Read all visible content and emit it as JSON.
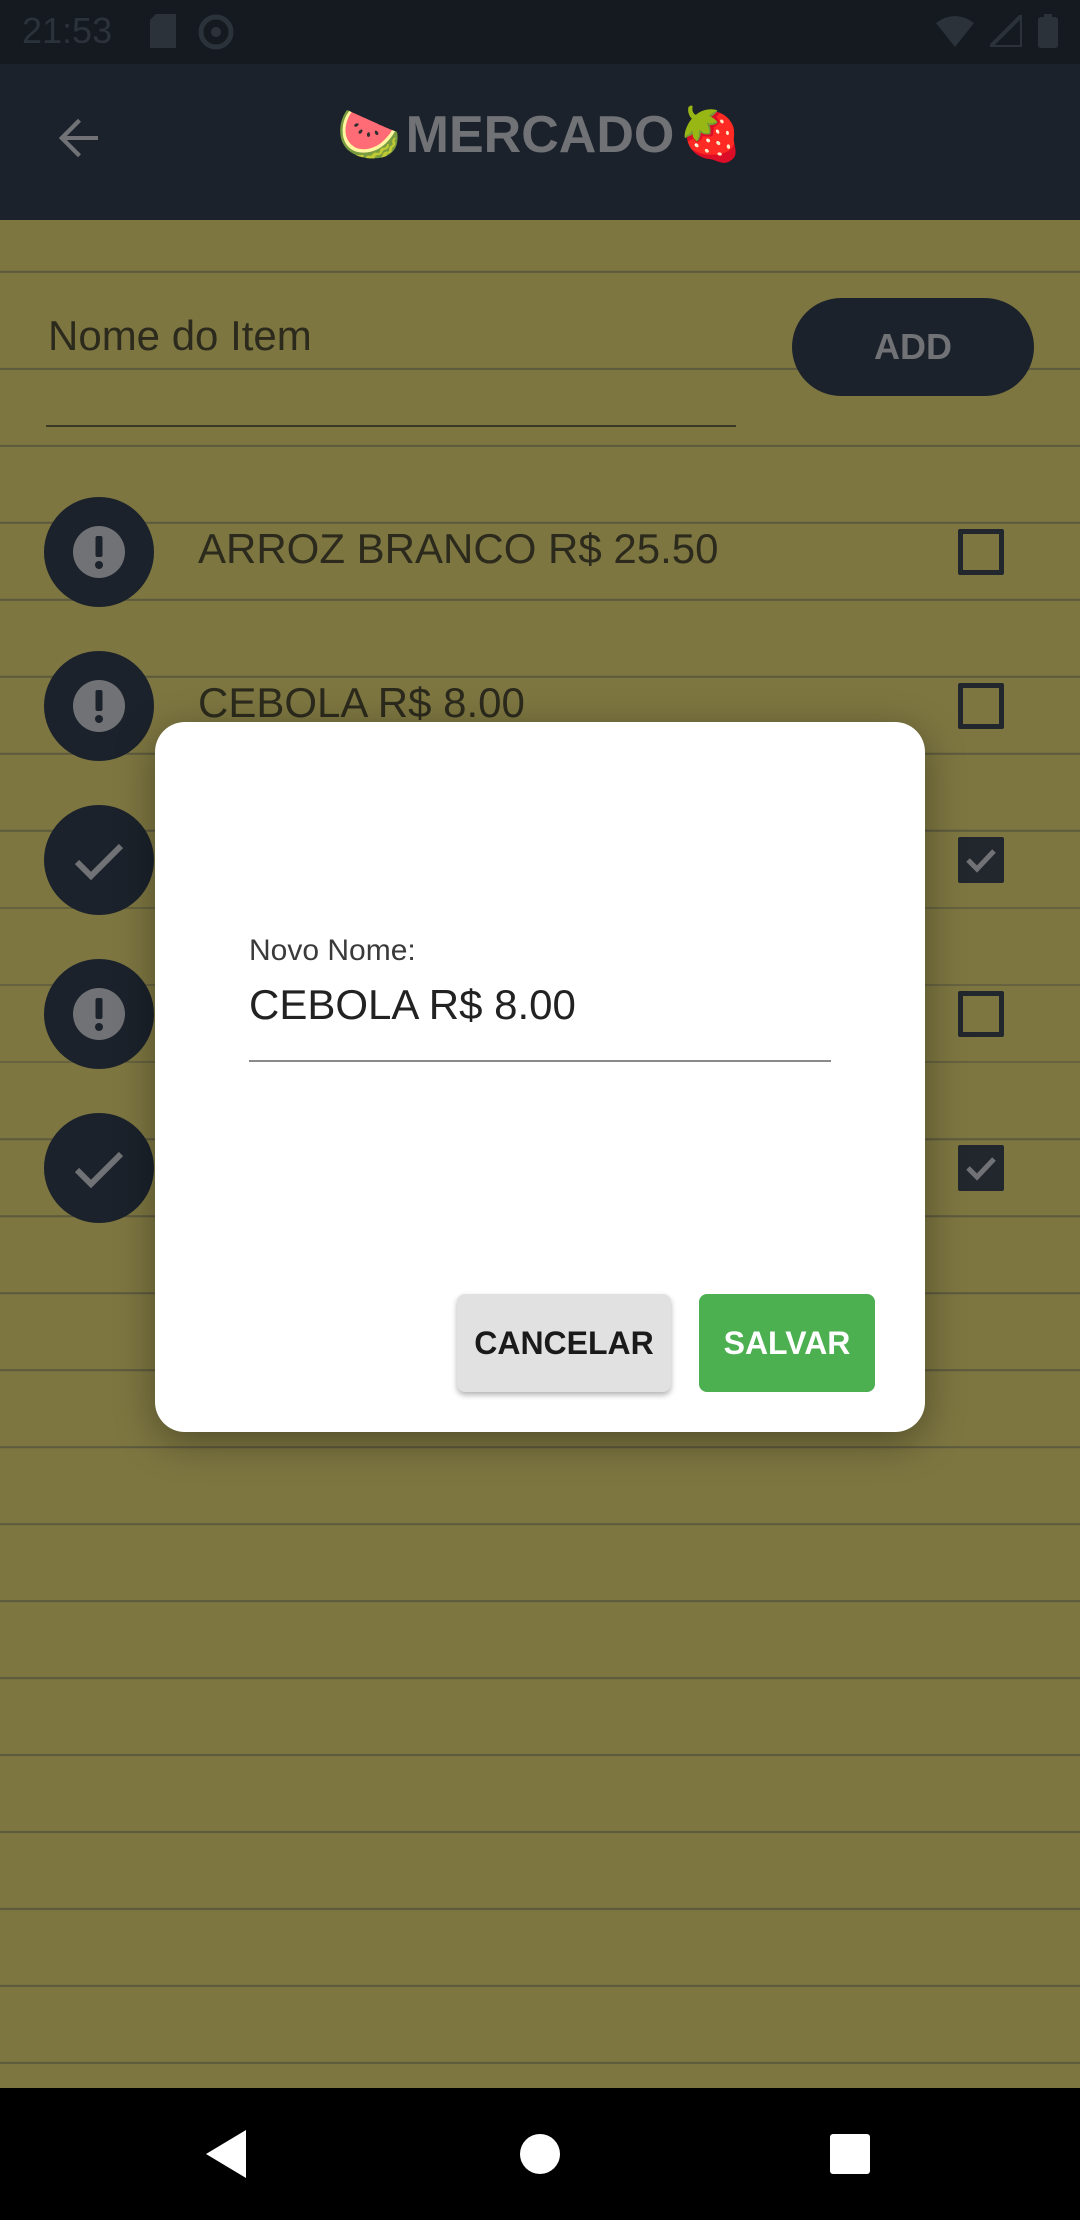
{
  "status_bar": {
    "time": "21:53"
  },
  "app_bar": {
    "title": "MERCADO",
    "title_emoji_left": "🍉",
    "title_emoji_right": "🍓"
  },
  "new_item": {
    "placeholder": "Nome do Item",
    "add_label": "ADD"
  },
  "items": [
    {
      "label": "ARROZ BRANCO R$ 25.50",
      "status": "pending",
      "checked": false
    },
    {
      "label": "CEBOLA R$ 8.00",
      "status": "pending",
      "checked": false
    },
    {
      "label": "",
      "status": "done",
      "checked": true
    },
    {
      "label": "",
      "status": "pending",
      "checked": false
    },
    {
      "label": "",
      "status": "done",
      "checked": true
    }
  ],
  "dialog": {
    "field_label": "Novo Nome:",
    "field_value": "CEBOLA R$ 8.00",
    "cancel_label": "CANCELAR",
    "save_label": "SALVAR"
  },
  "colors": {
    "accent_green": "#4caf50",
    "dark": "#1b222b",
    "paper": "#7d7641"
  }
}
